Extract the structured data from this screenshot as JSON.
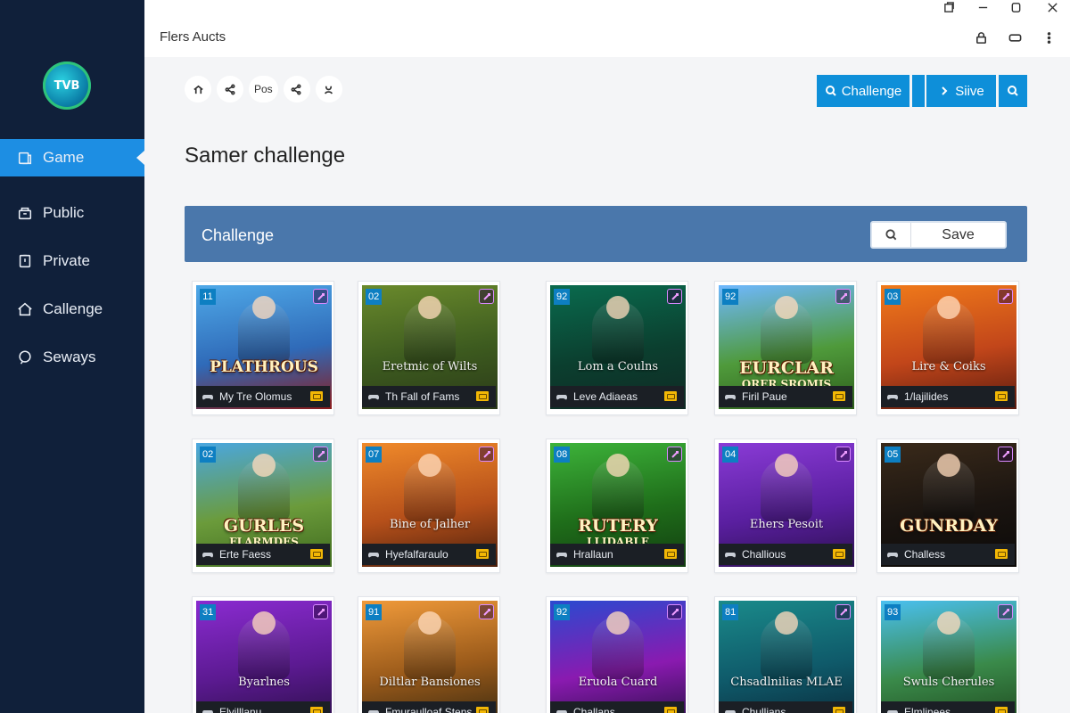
{
  "window": {
    "title": "Flers Aucts",
    "controls": [
      "pin-icon",
      "minimize-icon",
      "maximize-icon",
      "close-icon"
    ]
  },
  "topbar_icons": [
    "lock-icon",
    "toggle-icon",
    "more-vertical-icon"
  ],
  "sidebar": {
    "logo_text": "TVB",
    "items": [
      {
        "label": "Game",
        "icon": "game-icon",
        "active": true
      },
      {
        "label": "Public",
        "icon": "public-icon",
        "active": false
      },
      {
        "label": "Private",
        "icon": "private-icon",
        "active": false
      },
      {
        "label": "Callenge",
        "icon": "home-icon",
        "active": false
      },
      {
        "label": "Seways",
        "icon": "chat-icon",
        "active": false
      }
    ]
  },
  "toolbar": {
    "crumbs": [
      {
        "icon": "home-icon",
        "label": ""
      },
      {
        "icon": "share-icon",
        "label": ""
      },
      {
        "icon": "",
        "label": "Pos"
      },
      {
        "icon": "share-icon",
        "label": ""
      },
      {
        "icon": "user-icon",
        "label": ""
      }
    ],
    "challenge_button": "Challenge",
    "save_button": "Siive",
    "search_button_icon": "search-icon"
  },
  "page_title": "Samer challenge",
  "band": {
    "title": "Challenge",
    "save_label": "Save"
  },
  "accent_colors": {
    "sidebar_bg": "#10203a",
    "active_nav": "#1d8ee3",
    "primary_button": "#0e8fd9",
    "band_bg": "#4a77ab"
  },
  "games": [
    {
      "num": "11",
      "art_title": "PLATHROUS",
      "art_sub": "",
      "caption": "My Tre Olomus",
      "bg": [
        "#4fa9e8",
        "#2f6ab8",
        "#8b1b1b"
      ]
    },
    {
      "num": "02",
      "art_title": "",
      "art_sub": "Eretmic of Wilts",
      "caption": "Th Fall of Fams",
      "bg": [
        "#6a8a2c",
        "#3d5b1f",
        "#2b3a18"
      ]
    },
    {
      "num": "92",
      "art_title": "",
      "art_sub": "Lom a Coulns",
      "caption": "Leve Adiaeas",
      "bg": [
        "#0a6b4e",
        "#0b3f2f",
        "#0f2a24"
      ]
    },
    {
      "num": "92",
      "art_title": "EURCLAR",
      "art_sub": "ORER SROMIS",
      "caption": "Firil Paue",
      "bg": [
        "#6fb8ff",
        "#4f9a3b",
        "#2d5e1b"
      ]
    },
    {
      "num": "03",
      "art_title": "",
      "art_sub": "Lire & Coiks",
      "caption": "1/lajilides",
      "bg": [
        "#f07a1a",
        "#c2461a",
        "#5a1b0f"
      ]
    },
    {
      "num": "02",
      "art_title": "GURLES",
      "art_sub": "FLARMDES",
      "caption": "Erte Faess",
      "bg": [
        "#4aa7e0",
        "#6b9b3b",
        "#3f6a1e"
      ]
    },
    {
      "num": "07",
      "art_title": "",
      "art_sub": "Bine of Jalher",
      "caption": "Hyefalfaraulo",
      "bg": [
        "#f08a2a",
        "#b6501a",
        "#4a1f0c"
      ]
    },
    {
      "num": "08",
      "art_title": "RUTERY",
      "art_sub": "LLIDABLE",
      "caption": "Hrallaun",
      "bg": [
        "#3db33a",
        "#1f6e1a",
        "#123e10"
      ]
    },
    {
      "num": "04",
      "art_title": "",
      "art_sub": "Ehers Pesoit",
      "caption": "Challious",
      "bg": [
        "#8a3bd6",
        "#5a1fa0",
        "#2b0f4e"
      ]
    },
    {
      "num": "05",
      "art_title": "GUNRDAY",
      "art_sub": "",
      "caption": "Challess",
      "bg": [
        "#3a2a1a",
        "#1a1410",
        "#0c0a08"
      ]
    },
    {
      "num": "31",
      "art_title": "",
      "art_sub": "Byarlnes",
      "caption": "Elvjlllanu",
      "bg": [
        "#8a2bd0",
        "#5c1a92",
        "#2b0f48"
      ]
    },
    {
      "num": "91",
      "art_title": "",
      "art_sub": "Diltlar Bansiones",
      "caption": "Fmuraulloaf Stens",
      "bg": [
        "#f09a3a",
        "#9a5a1a",
        "#3a2a10"
      ]
    },
    {
      "num": "92",
      "art_title": "",
      "art_sub": "Eruola Cuard",
      "caption": "Challans",
      "bg": [
        "#2a4ad0",
        "#8a1ab0",
        "#2a0f48"
      ]
    },
    {
      "num": "81",
      "art_title": "",
      "art_sub": "Chsadlnilias MLAE",
      "caption": "Chullians",
      "bg": [
        "#1a8a8a",
        "#0f5a6a",
        "#0a2a3a"
      ]
    },
    {
      "num": "93",
      "art_title": "",
      "art_sub": "Swuls Cherules",
      "caption": "Elmlinees",
      "bg": [
        "#4ac0f0",
        "#3a8a4a",
        "#1f4a1f"
      ]
    }
  ]
}
